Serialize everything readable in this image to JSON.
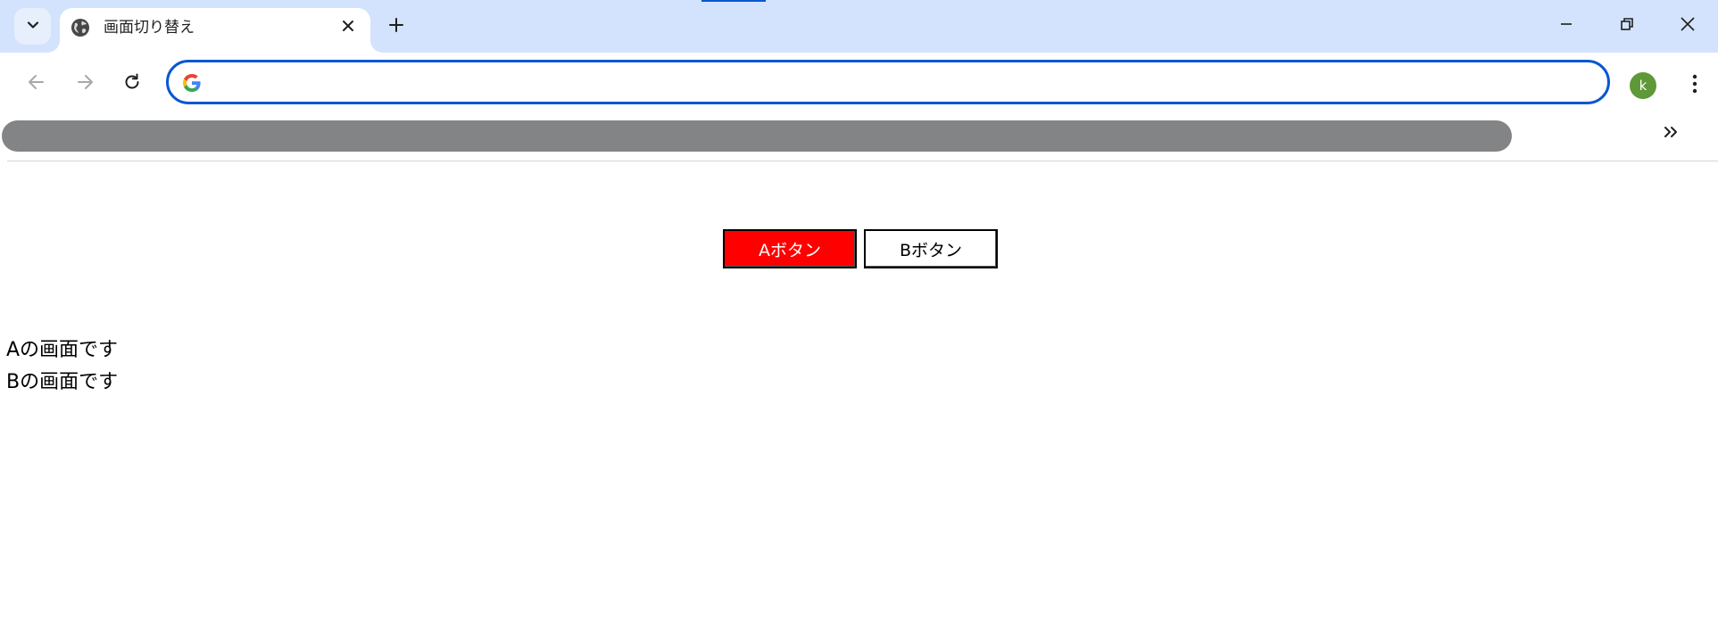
{
  "browser": {
    "tab": {
      "title": "画面切り替え"
    },
    "omnibox": {
      "value": "",
      "placeholder": ""
    },
    "profile": {
      "initial": "k",
      "color": "#5f9838"
    },
    "accent_color": "#0b57d0",
    "tabstrip_color": "#d3e3fd",
    "icons": {
      "tab_search": "chevron-down-icon",
      "favicon": "globe-icon",
      "tab_close": "close-icon",
      "new_tab": "plus-icon",
      "back": "arrow-left-icon",
      "forward": "arrow-right-icon",
      "reload": "reload-icon",
      "omnibox": "google-g-icon",
      "menu": "kebab-menu-icon",
      "bookmarks_overflow": "double-chevron-right-icon",
      "minimize": "minimize-icon",
      "restore": "restore-icon",
      "window_close": "close-icon"
    }
  },
  "page": {
    "buttons": {
      "a_label": "Aボタン",
      "b_label": "Bボタン",
      "a_color": "#ff0000",
      "b_color": "#ffffff"
    },
    "screens": {
      "a_text": "Aの画面です",
      "b_text": "Bの画面です"
    }
  }
}
